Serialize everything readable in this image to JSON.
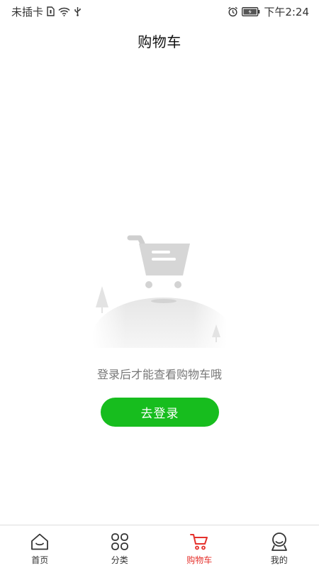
{
  "status_bar": {
    "carrier": "未插卡",
    "time": "下午2:24",
    "icons": [
      "sim-card-icon",
      "wifi-icon",
      "usb-icon",
      "alarm-icon",
      "battery-charging-icon"
    ]
  },
  "header": {
    "title": "购物车"
  },
  "empty_state": {
    "illustration": "shopping-cart-illustration",
    "message": "登录后才能查看购物车哦",
    "login_button": "去登录"
  },
  "bottom_nav": {
    "active": "cart",
    "accent_color": "#e5312c",
    "items": [
      {
        "label": "首页",
        "icon": "home-icon"
      },
      {
        "label": "分类",
        "icon": "category-icon"
      },
      {
        "label": "购物车",
        "icon": "cart-icon"
      },
      {
        "label": "我的",
        "icon": "profile-icon"
      }
    ]
  },
  "colors": {
    "primary_button": "#17bd1e",
    "active_tab": "#e5312c"
  }
}
